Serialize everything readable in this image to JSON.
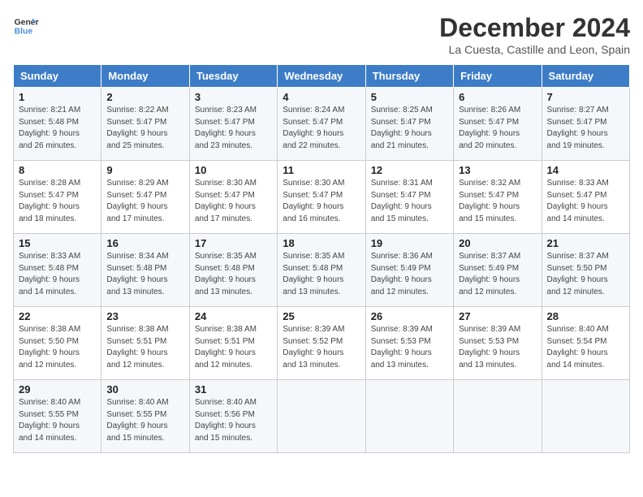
{
  "logo": {
    "line1": "General",
    "line2": "Blue"
  },
  "title": "December 2024",
  "location": "La Cuesta, Castille and Leon, Spain",
  "days_of_week": [
    "Sunday",
    "Monday",
    "Tuesday",
    "Wednesday",
    "Thursday",
    "Friday",
    "Saturday"
  ],
  "weeks": [
    [
      {
        "day": "1",
        "info": "Sunrise: 8:21 AM\nSunset: 5:48 PM\nDaylight: 9 hours\nand 26 minutes."
      },
      {
        "day": "2",
        "info": "Sunrise: 8:22 AM\nSunset: 5:47 PM\nDaylight: 9 hours\nand 25 minutes."
      },
      {
        "day": "3",
        "info": "Sunrise: 8:23 AM\nSunset: 5:47 PM\nDaylight: 9 hours\nand 23 minutes."
      },
      {
        "day": "4",
        "info": "Sunrise: 8:24 AM\nSunset: 5:47 PM\nDaylight: 9 hours\nand 22 minutes."
      },
      {
        "day": "5",
        "info": "Sunrise: 8:25 AM\nSunset: 5:47 PM\nDaylight: 9 hours\nand 21 minutes."
      },
      {
        "day": "6",
        "info": "Sunrise: 8:26 AM\nSunset: 5:47 PM\nDaylight: 9 hours\nand 20 minutes."
      },
      {
        "day": "7",
        "info": "Sunrise: 8:27 AM\nSunset: 5:47 PM\nDaylight: 9 hours\nand 19 minutes."
      }
    ],
    [
      {
        "day": "8",
        "info": "Sunrise: 8:28 AM\nSunset: 5:47 PM\nDaylight: 9 hours\nand 18 minutes."
      },
      {
        "day": "9",
        "info": "Sunrise: 8:29 AM\nSunset: 5:47 PM\nDaylight: 9 hours\nand 17 minutes."
      },
      {
        "day": "10",
        "info": "Sunrise: 8:30 AM\nSunset: 5:47 PM\nDaylight: 9 hours\nand 17 minutes."
      },
      {
        "day": "11",
        "info": "Sunrise: 8:30 AM\nSunset: 5:47 PM\nDaylight: 9 hours\nand 16 minutes."
      },
      {
        "day": "12",
        "info": "Sunrise: 8:31 AM\nSunset: 5:47 PM\nDaylight: 9 hours\nand 15 minutes."
      },
      {
        "day": "13",
        "info": "Sunrise: 8:32 AM\nSunset: 5:47 PM\nDaylight: 9 hours\nand 15 minutes."
      },
      {
        "day": "14",
        "info": "Sunrise: 8:33 AM\nSunset: 5:47 PM\nDaylight: 9 hours\nand 14 minutes."
      }
    ],
    [
      {
        "day": "15",
        "info": "Sunrise: 8:33 AM\nSunset: 5:48 PM\nDaylight: 9 hours\nand 14 minutes."
      },
      {
        "day": "16",
        "info": "Sunrise: 8:34 AM\nSunset: 5:48 PM\nDaylight: 9 hours\nand 13 minutes."
      },
      {
        "day": "17",
        "info": "Sunrise: 8:35 AM\nSunset: 5:48 PM\nDaylight: 9 hours\nand 13 minutes."
      },
      {
        "day": "18",
        "info": "Sunrise: 8:35 AM\nSunset: 5:48 PM\nDaylight: 9 hours\nand 13 minutes."
      },
      {
        "day": "19",
        "info": "Sunrise: 8:36 AM\nSunset: 5:49 PM\nDaylight: 9 hours\nand 12 minutes."
      },
      {
        "day": "20",
        "info": "Sunrise: 8:37 AM\nSunset: 5:49 PM\nDaylight: 9 hours\nand 12 minutes."
      },
      {
        "day": "21",
        "info": "Sunrise: 8:37 AM\nSunset: 5:50 PM\nDaylight: 9 hours\nand 12 minutes."
      }
    ],
    [
      {
        "day": "22",
        "info": "Sunrise: 8:38 AM\nSunset: 5:50 PM\nDaylight: 9 hours\nand 12 minutes."
      },
      {
        "day": "23",
        "info": "Sunrise: 8:38 AM\nSunset: 5:51 PM\nDaylight: 9 hours\nand 12 minutes."
      },
      {
        "day": "24",
        "info": "Sunrise: 8:38 AM\nSunset: 5:51 PM\nDaylight: 9 hours\nand 12 minutes."
      },
      {
        "day": "25",
        "info": "Sunrise: 8:39 AM\nSunset: 5:52 PM\nDaylight: 9 hours\nand 13 minutes."
      },
      {
        "day": "26",
        "info": "Sunrise: 8:39 AM\nSunset: 5:53 PM\nDaylight: 9 hours\nand 13 minutes."
      },
      {
        "day": "27",
        "info": "Sunrise: 8:39 AM\nSunset: 5:53 PM\nDaylight: 9 hours\nand 13 minutes."
      },
      {
        "day": "28",
        "info": "Sunrise: 8:40 AM\nSunset: 5:54 PM\nDaylight: 9 hours\nand 14 minutes."
      }
    ],
    [
      {
        "day": "29",
        "info": "Sunrise: 8:40 AM\nSunset: 5:55 PM\nDaylight: 9 hours\nand 14 minutes."
      },
      {
        "day": "30",
        "info": "Sunrise: 8:40 AM\nSunset: 5:55 PM\nDaylight: 9 hours\nand 15 minutes."
      },
      {
        "day": "31",
        "info": "Sunrise: 8:40 AM\nSunset: 5:56 PM\nDaylight: 9 hours\nand 15 minutes."
      },
      null,
      null,
      null,
      null
    ]
  ]
}
